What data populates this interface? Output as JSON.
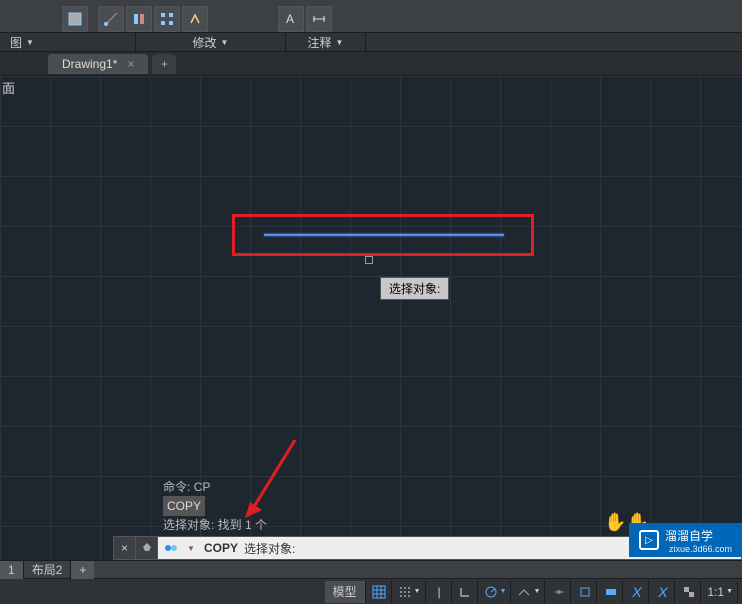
{
  "panels": {
    "p1": "图",
    "p2": "修改",
    "p3": "注释"
  },
  "tab": {
    "name": "Drawing1*"
  },
  "side": "面",
  "tooltip": "选择对象:",
  "history": {
    "line1_prefix": "命令:",
    "line1_cmd": "CP",
    "copy_label": "COPY",
    "line3": "选择对象: 找到 1 个"
  },
  "cmdline": {
    "command": "COPY",
    "prompt": "选择对象:"
  },
  "layout_tabs": {
    "t1": "1",
    "t2": "布局2"
  },
  "status": {
    "model": "模型",
    "scale": "1:1"
  },
  "watermark": {
    "brand": "溜溜自学",
    "url": "zixue.3d66.com"
  }
}
